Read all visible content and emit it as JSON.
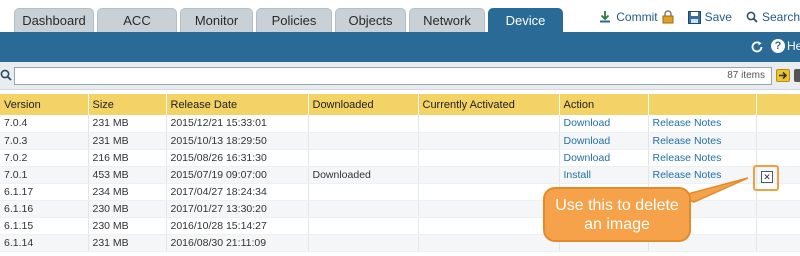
{
  "nav": {
    "tabs": [
      {
        "label": "Dashboard",
        "active": false
      },
      {
        "label": "ACC",
        "active": false
      },
      {
        "label": "Monitor",
        "active": false
      },
      {
        "label": "Policies",
        "active": false
      },
      {
        "label": "Objects",
        "active": false
      },
      {
        "label": "Network",
        "active": false
      },
      {
        "label": "Device",
        "active": true
      }
    ],
    "actions": {
      "commit": "Commit",
      "save": "Save",
      "search": "Search"
    }
  },
  "toolbar": {
    "help": "Help"
  },
  "filter": {
    "placeholder": "",
    "item_count": "87 items"
  },
  "table": {
    "columns": [
      "Version",
      "Size",
      "Release Date",
      "Downloaded",
      "Currently Activated",
      "Action",
      "",
      ""
    ],
    "rows": [
      {
        "version": "7.0.4",
        "size": "231 MB",
        "release_date": "2015/12/21 15:33:01",
        "downloaded": "",
        "activated": "",
        "action": "Download",
        "notes": "Release Notes"
      },
      {
        "version": "7.0.3",
        "size": "231 MB",
        "release_date": "2015/10/13 18:29:50",
        "downloaded": "",
        "activated": "",
        "action": "Download",
        "notes": "Release Notes"
      },
      {
        "version": "7.0.2",
        "size": "216 MB",
        "release_date": "2015/08/26 16:31:30",
        "downloaded": "",
        "activated": "",
        "action": "Download",
        "notes": "Release Notes"
      },
      {
        "version": "7.0.1",
        "size": "453 MB",
        "release_date": "2015/07/19 09:07:00",
        "downloaded": "Downloaded",
        "activated": "",
        "action": "Install",
        "notes": "Release Notes"
      },
      {
        "version": "6.1.17",
        "size": "234 MB",
        "release_date": "2017/04/27 18:24:34",
        "downloaded": "",
        "activated": "",
        "action": "",
        "notes": ""
      },
      {
        "version": "6.1.16",
        "size": "230 MB",
        "release_date": "2017/01/27 13:30:20",
        "downloaded": "",
        "activated": "",
        "action": "",
        "notes": ""
      },
      {
        "version": "6.1.15",
        "size": "230 MB",
        "release_date": "2016/10/28 15:14:27",
        "downloaded": "",
        "activated": "",
        "action": "",
        "notes": ""
      },
      {
        "version": "6.1.14",
        "size": "231 MB",
        "release_date": "2016/08/30 21:11:09",
        "downloaded": "",
        "activated": "",
        "action": "",
        "notes": ""
      }
    ]
  },
  "callout": {
    "line1": "Use this to delete",
    "line2": "an image"
  },
  "colors": {
    "accent_blue": "#2a6a97",
    "header_yellow": "#f3d365",
    "callout_orange": "#f5a24a",
    "link_blue": "#1f6fa8"
  }
}
